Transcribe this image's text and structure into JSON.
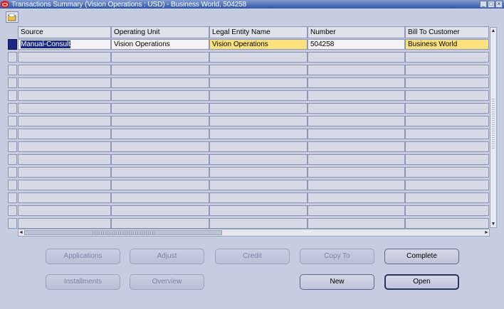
{
  "window": {
    "title": "Transactions Summary (Vision Operations : USD) - Business World, 504258",
    "controls": [
      "_",
      "□",
      "×"
    ]
  },
  "table": {
    "headers": [
      "Source",
      "Operating Unit",
      "Legal Entity Name",
      "Number",
      "Bill To Customer"
    ],
    "rows": [
      [
        "Manual-Consult",
        "Vision Operations",
        "Vision Operations",
        "504258",
        "Business World"
      ]
    ],
    "empty_rows": 14
  },
  "buttons": {
    "applications": "Applications",
    "adjust": "Adjust",
    "credit": "Credit",
    "copy_to": "Copy To",
    "complete": "Complete",
    "installments": "Installments",
    "overview": "Overview",
    "new": "New",
    "open": "Open"
  },
  "colors": {
    "background": "#c7cde0",
    "title_bar": "#2f56a8",
    "highlight_yellow": "#fbe27e",
    "selection": "#1a2a80"
  }
}
